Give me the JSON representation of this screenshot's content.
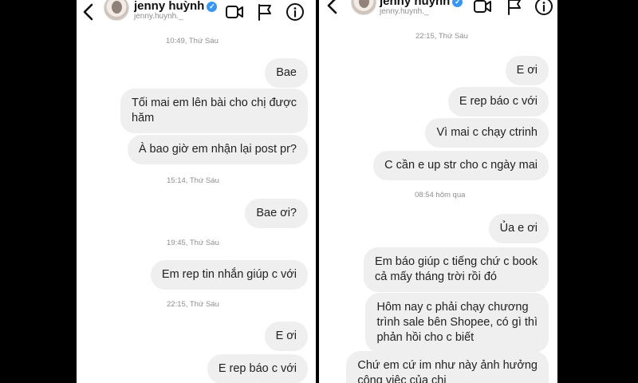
{
  "left": {
    "contact_name": "jenny huỳnh",
    "username": "jenny.huynh._",
    "messages": [
      {
        "type": "timestamp",
        "text": "10:49, Thứ Sáu"
      },
      {
        "type": "bubble",
        "text": "Bae"
      },
      {
        "type": "bubble",
        "lines": [
          "Tối mai em lên bài cho chị được",
          "hăm"
        ]
      },
      {
        "type": "bubble",
        "text": "À bao giờ em nhận lại post pr?"
      },
      {
        "type": "timestamp",
        "text": "15:14, Thứ Sáu"
      },
      {
        "type": "bubble",
        "text": "Bae ơi?"
      },
      {
        "type": "timestamp",
        "text": "19:45, Thứ Sáu"
      },
      {
        "type": "bubble",
        "text": "Em rep tin nhắn giúp c với"
      },
      {
        "type": "timestamp",
        "text": "22:15, Thứ Sáu"
      },
      {
        "type": "bubble",
        "text": "E ơi"
      },
      {
        "type": "bubble",
        "text": "E rep báo c với"
      }
    ]
  },
  "right": {
    "contact_name": "jenny huỳnh",
    "username": "jenny.huynh._",
    "messages": [
      {
        "type": "timestamp",
        "text": "22:15, Thứ Sáu"
      },
      {
        "type": "bubble",
        "text": "E ơi"
      },
      {
        "type": "bubble",
        "text": "E rep báo c với"
      },
      {
        "type": "bubble",
        "text": "Vì mai c chạy ctrinh"
      },
      {
        "type": "bubble",
        "text": "C cần e up str cho c ngày mai"
      },
      {
        "type": "timestamp",
        "text": "08:54 hôm qua"
      },
      {
        "type": "bubble",
        "text": "Ủa e ơi"
      },
      {
        "type": "bubble",
        "lines": [
          "Em báo giúp c tiếng chứ c book",
          "cả mấy tháng trời rồi đó"
        ]
      },
      {
        "type": "bubble",
        "lines": [
          "Hôm nay c phải chạy chương",
          "trình sale bên Shopee, có gì thì",
          "phản hồi cho c biết"
        ]
      },
      {
        "type": "bubble",
        "lines": [
          "Chứ em cứ im như này ảnh hưởng",
          "công việc của chị"
        ]
      }
    ]
  },
  "icons": [
    "back-icon",
    "avatar",
    "verified-icon",
    "video-call-icon",
    "flag-icon",
    "info-icon"
  ],
  "colors": {
    "bubble": "#efefef",
    "verified": "#3897f0",
    "timestamp": "#8e8e8e",
    "background": "#000000"
  }
}
